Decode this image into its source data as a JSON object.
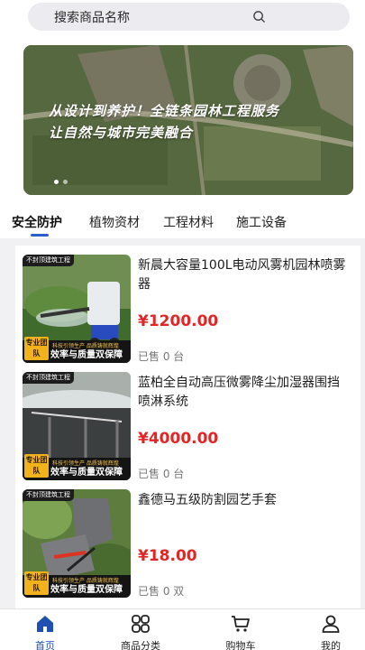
{
  "search": {
    "placeholder": "搜索商品名称"
  },
  "banner": {
    "line1": "从设计到养护！全链条园林工程服务",
    "line2": "让自然与城市完美融合"
  },
  "tabs": [
    {
      "label": "安全防护",
      "active": true
    },
    {
      "label": "植物资材",
      "active": false
    },
    {
      "label": "工程材料",
      "active": false
    },
    {
      "label": "施工设备",
      "active": false
    }
  ],
  "thumb_labels": {
    "top": "不封顶建筑工程",
    "badge": "专业团队",
    "small": "科技引领生产  品质铸就辉煌",
    "main": "效率与质量双保障"
  },
  "products": [
    {
      "title": "新晨大容量100L电动风雾机园林喷雾器",
      "price": "¥1200.00",
      "sold": "已售 0 台"
    },
    {
      "title": "蓝柏全自动高压微雾降尘加湿器围挡喷淋系统",
      "price": "¥4000.00",
      "sold": "已售 0 台"
    },
    {
      "title": "鑫德马五级防割园艺手套",
      "price": "¥18.00",
      "sold": "已售 0 双"
    }
  ],
  "bottom_nav": [
    {
      "label": "首页",
      "icon": "home-icon",
      "active": true
    },
    {
      "label": "商品分类",
      "icon": "category-icon",
      "active": false
    },
    {
      "label": "购物车",
      "icon": "cart-icon",
      "active": false
    },
    {
      "label": "我的",
      "icon": "user-icon",
      "active": false
    }
  ],
  "colors": {
    "accent": "#1f4fb0",
    "price": "#e12626",
    "badge": "#f2b21b"
  }
}
